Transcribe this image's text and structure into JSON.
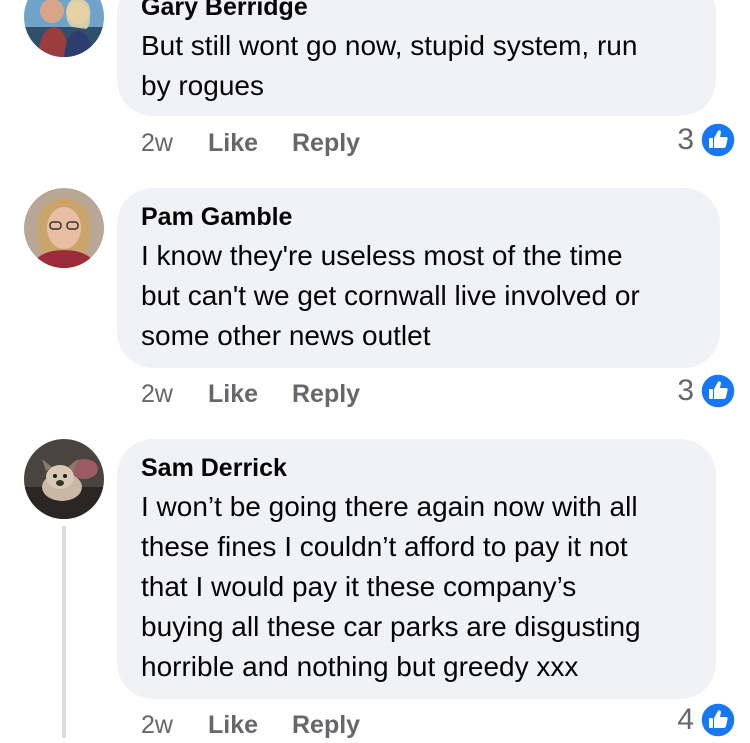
{
  "comments": [
    {
      "author": "Gary Berridge",
      "lines": [
        "But still wont go now, stupid system, run",
        "by rogues"
      ],
      "time": "2w",
      "like": "Like",
      "reply": "Reply",
      "reactions": "3",
      "reaction_icon": "thumbs-up-icon",
      "avatar_icon": "couple-photo-avatar"
    },
    {
      "author": "Pam Gamble",
      "lines": [
        "I know they're useless most of the time",
        "but can't we get cornwall live involved or",
        "some other news outlet"
      ],
      "time": "2w",
      "like": "Like",
      "reply": "Reply",
      "reactions": "3",
      "reaction_icon": "thumbs-up-icon",
      "avatar_icon": "woman-photo-avatar"
    },
    {
      "author": "Sam Derrick",
      "lines": [
        "I won’t be going there again now with all",
        "these fines I couldn’t afford to pay it not",
        "that I would pay it these company’s",
        "buying all these car parks are disgusting",
        "horrible and nothing but greedy xxx"
      ],
      "time": "2w",
      "like": "Like",
      "reply": "Reply",
      "reactions": "4",
      "reaction_icon": "thumbs-up-icon",
      "avatar_icon": "dog-photo-avatar"
    }
  ],
  "colors": {
    "bubble": "#f0f2f5",
    "meta_text": "#65676b",
    "like_blue": "#1877f2",
    "thread_line": "#dadde1"
  }
}
